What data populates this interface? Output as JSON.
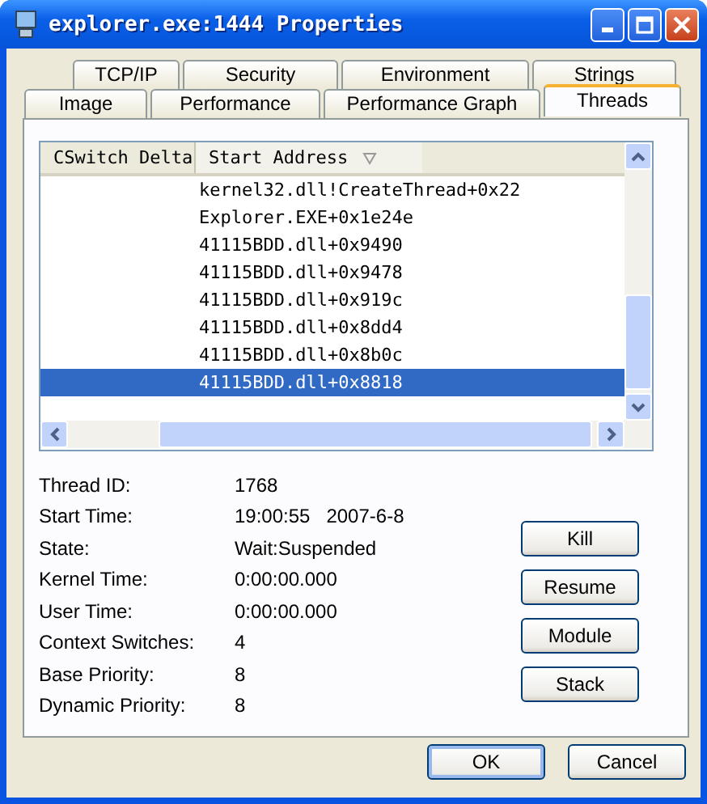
{
  "window": {
    "title": "explorer.exe:1444 Properties"
  },
  "tab_rows": [
    [
      {
        "label": "TCP/IP",
        "selected": false
      },
      {
        "label": "Security",
        "selected": false
      },
      {
        "label": "Environment",
        "selected": false
      },
      {
        "label": "Strings",
        "selected": false
      }
    ],
    [
      {
        "label": "Image",
        "selected": false
      },
      {
        "label": "Performance",
        "selected": false
      },
      {
        "label": "Performance Graph",
        "selected": false
      },
      {
        "label": "Threads",
        "selected": true
      }
    ]
  ],
  "thread_list": {
    "columns": [
      {
        "label": "CSwitch Delta",
        "sorted": false
      },
      {
        "label": "Start Address",
        "sorted": true
      }
    ],
    "rows": [
      {
        "start_address": "kernel32.dll!CreateThread+0x22",
        "selected": false
      },
      {
        "start_address": "Explorer.EXE+0x1e24e",
        "selected": false
      },
      {
        "start_address": "41115BDD.dll+0x9490",
        "selected": false
      },
      {
        "start_address": "41115BDD.dll+0x9478",
        "selected": false
      },
      {
        "start_address": "41115BDD.dll+0x919c",
        "selected": false
      },
      {
        "start_address": "41115BDD.dll+0x8dd4",
        "selected": false
      },
      {
        "start_address": "41115BDD.dll+0x8b0c",
        "selected": false
      },
      {
        "start_address": "41115BDD.dll+0x8818",
        "selected": true
      }
    ]
  },
  "details": [
    {
      "label": "Thread ID:",
      "value": "1768"
    },
    {
      "label": "Start Time:",
      "value": "19:00:55   2007-6-8"
    },
    {
      "label": "State:",
      "value": "Wait:Suspended"
    },
    {
      "label": "Kernel Time:",
      "value": "0:00:00.000"
    },
    {
      "label": "User Time:",
      "value": "0:00:00.000"
    },
    {
      "label": "Context Switches:",
      "value": "4"
    },
    {
      "label": "Base Priority:",
      "value": "8"
    },
    {
      "label": "Dynamic Priority:",
      "value": "8"
    }
  ],
  "thread_buttons": [
    "Kill",
    "Resume",
    "Module",
    "Stack"
  ],
  "dialog_buttons": [
    {
      "label": "OK",
      "default": true
    },
    {
      "label": "Cancel",
      "default": false
    }
  ]
}
